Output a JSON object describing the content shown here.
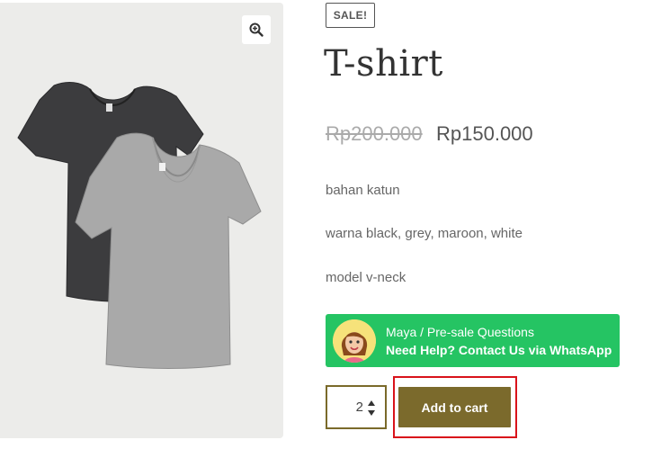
{
  "gallery": {
    "zoom_icon": "zoom-in-icon",
    "image": "t-shirt-product-photo"
  },
  "product": {
    "sale_badge": "SALE!",
    "title": "T-shirt",
    "price_old": "Rp200.000",
    "price_new": "Rp150.000",
    "description": [
      "bahan katun",
      "warna black, grey, maroon, white",
      "model v-neck"
    ]
  },
  "whatsapp": {
    "line1": "Maya / Pre-sale Questions",
    "line2": "Need Help? Contact Us via WhatsApp",
    "avatar_icon": "agent-avatar-icon",
    "color": "#25c463"
  },
  "cart": {
    "quantity": "2",
    "add_to_cart_label": "Add to cart",
    "button_color": "#7b6a2c",
    "highlight_color": "#d9131b"
  }
}
